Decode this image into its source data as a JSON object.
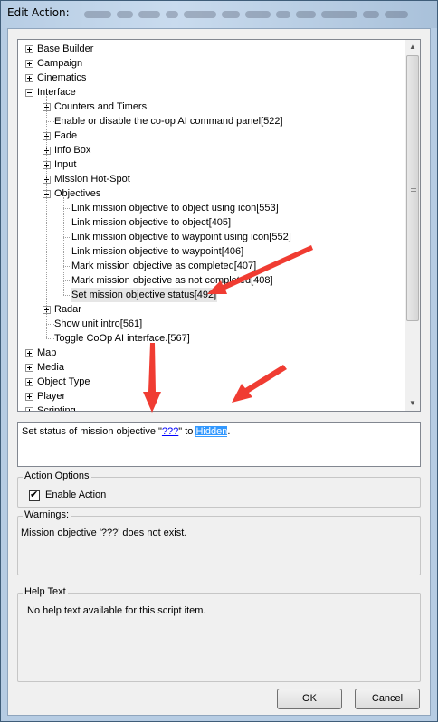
{
  "window": {
    "title": "Edit Action:"
  },
  "tree": {
    "items": [
      {
        "label": "Base Builder",
        "level": 0,
        "expander": "plus"
      },
      {
        "label": "Campaign",
        "level": 0,
        "expander": "plus"
      },
      {
        "label": "Cinematics",
        "level": 0,
        "expander": "plus"
      },
      {
        "label": "Interface",
        "level": 0,
        "expander": "minus"
      },
      {
        "label": "Counters and Timers",
        "level": 1,
        "expander": "plus"
      },
      {
        "label": "Enable or disable the co-op AI command panel[522]",
        "level": 1,
        "expander": "none"
      },
      {
        "label": "Fade",
        "level": 1,
        "expander": "plus"
      },
      {
        "label": "Info Box",
        "level": 1,
        "expander": "plus"
      },
      {
        "label": "Input",
        "level": 1,
        "expander": "plus"
      },
      {
        "label": "Mission Hot-Spot",
        "level": 1,
        "expander": "plus"
      },
      {
        "label": "Objectives",
        "level": 1,
        "expander": "minus"
      },
      {
        "label": "Link mission objective to object using icon[553]",
        "level": 2,
        "expander": "none"
      },
      {
        "label": "Link mission objective to object[405]",
        "level": 2,
        "expander": "none"
      },
      {
        "label": "Link mission objective to waypoint using icon[552]",
        "level": 2,
        "expander": "none"
      },
      {
        "label": "Link mission objective to waypoint[406]",
        "level": 2,
        "expander": "none"
      },
      {
        "label": "Mark mission objective as completed[407]",
        "level": 2,
        "expander": "none"
      },
      {
        "label": "Mark mission objective as not completed[408]",
        "level": 2,
        "expander": "none"
      },
      {
        "label": "Set mission objective status[492]",
        "level": 2,
        "expander": "none",
        "selected": true
      },
      {
        "label": "Radar",
        "level": 1,
        "expander": "plus"
      },
      {
        "label": "Show unit intro[561]",
        "level": 1,
        "expander": "none"
      },
      {
        "label": "Toggle CoOp AI interface.[567]",
        "level": 1,
        "expander": "none"
      },
      {
        "label": "Map",
        "level": 0,
        "expander": "plus"
      },
      {
        "label": "Media",
        "level": 0,
        "expander": "plus"
      },
      {
        "label": "Object Type",
        "level": 0,
        "expander": "plus"
      },
      {
        "label": "Player",
        "level": 0,
        "expander": "plus"
      },
      {
        "label": "Scripting",
        "level": 0,
        "expander": "plus"
      }
    ]
  },
  "description": {
    "prefix": "Set status of mission objective \"",
    "param1": "???",
    "middle": "\" to ",
    "param2": "Hidden",
    "suffix": "."
  },
  "action_options": {
    "title": "Action Options",
    "enable_label": "Enable Action",
    "enabled": true
  },
  "warnings": {
    "title": "Warnings:",
    "text": "Mission objective '???' does not exist."
  },
  "help": {
    "title": "Help Text",
    "text": "No help text available for this script item."
  },
  "buttons": {
    "ok": "OK",
    "cancel": "Cancel"
  },
  "colors": {
    "annotation": "#f03c32",
    "link": "#0000ff",
    "highlight": "#3399ff"
  }
}
